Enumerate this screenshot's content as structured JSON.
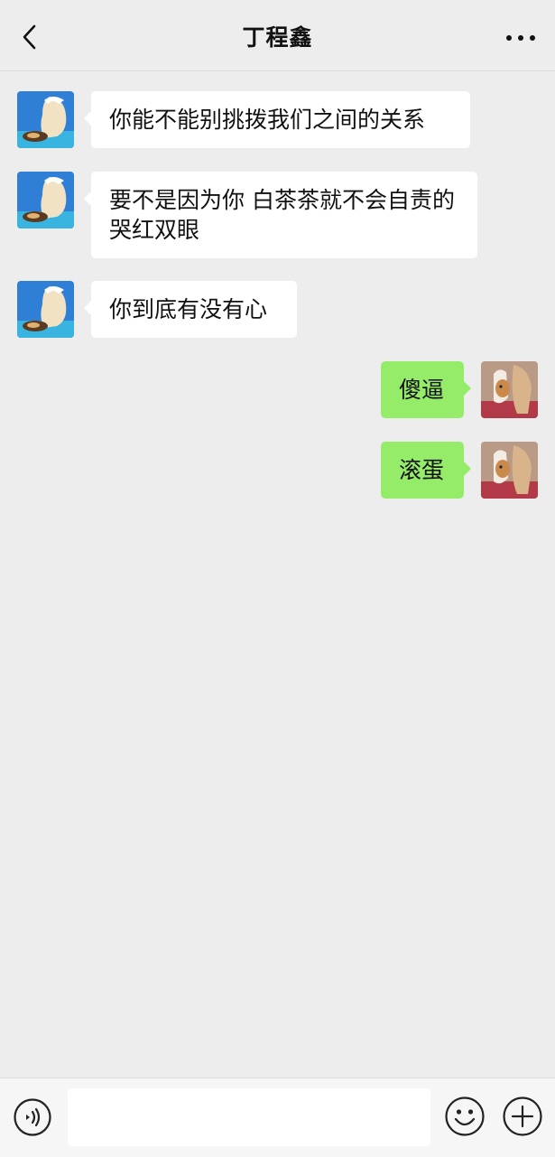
{
  "header": {
    "title": "丁程鑫"
  },
  "messages": [
    {
      "side": "left",
      "avatar": "blue-anime-avatar",
      "text": "你能不能别挑拨我们之间的关系"
    },
    {
      "side": "left",
      "avatar": "blue-anime-avatar",
      "text": "要不是因为你 白茶茶就不会自责的哭红双眼"
    },
    {
      "side": "left",
      "avatar": "blue-anime-avatar",
      "text": "你到底有没有心"
    },
    {
      "side": "right",
      "avatar": "dog-photo-avatar",
      "text": "傻逼"
    },
    {
      "side": "right",
      "avatar": "dog-photo-avatar",
      "text": "滚蛋"
    }
  ],
  "footer": {
    "input_value": "",
    "icons": [
      "voice-icon",
      "emoji-icon",
      "plus-icon"
    ]
  },
  "colors": {
    "background": "#EDEDED",
    "incoming_bubble": "#FFFFFF",
    "outgoing_bubble": "#95EC69"
  }
}
